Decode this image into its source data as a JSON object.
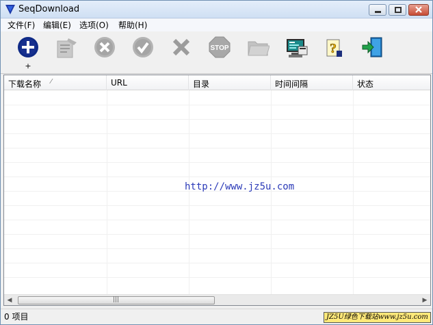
{
  "window": {
    "title": "SeqDownload"
  },
  "menu": [
    {
      "label": "文件(F)"
    },
    {
      "label": "编辑(E)"
    },
    {
      "label": "选项(O)"
    },
    {
      "label": "帮助(H)"
    }
  ],
  "toolbar": {
    "add_caption": "+",
    "buttons": [
      {
        "icon": "add-icon",
        "enabled": true
      },
      {
        "icon": "edit-icon",
        "enabled": false
      },
      {
        "icon": "cancel-icon",
        "enabled": false
      },
      {
        "icon": "check-icon",
        "enabled": false
      },
      {
        "icon": "delete-icon",
        "enabled": false
      },
      {
        "icon": "stop-icon",
        "enabled": false,
        "label": "STOP"
      },
      {
        "icon": "folder-icon",
        "enabled": false
      },
      {
        "icon": "computer-settings-icon",
        "enabled": true
      },
      {
        "icon": "help-icon",
        "enabled": true
      },
      {
        "icon": "exit-icon",
        "enabled": true
      }
    ]
  },
  "list": {
    "columns": [
      {
        "label": "下载名称"
      },
      {
        "label": "URL"
      },
      {
        "label": "目录"
      },
      {
        "label": "时间间隔"
      },
      {
        "label": "状态"
      }
    ],
    "sorted_column_marker": "⁄",
    "rows": [],
    "overlay_text": "http://www.jz5u.com"
  },
  "scrollbar": {
    "left_arrow": "◀",
    "right_arrow": "▶",
    "grip": "|||"
  },
  "status": {
    "text": "0 项目",
    "badge": "JZ5U绿色下载站www.jz5u.com"
  },
  "colors": {
    "accent_blue": "#1a3a8c",
    "overlay_text": "#2b3ab8",
    "badge_bg": "#ffe97a"
  }
}
